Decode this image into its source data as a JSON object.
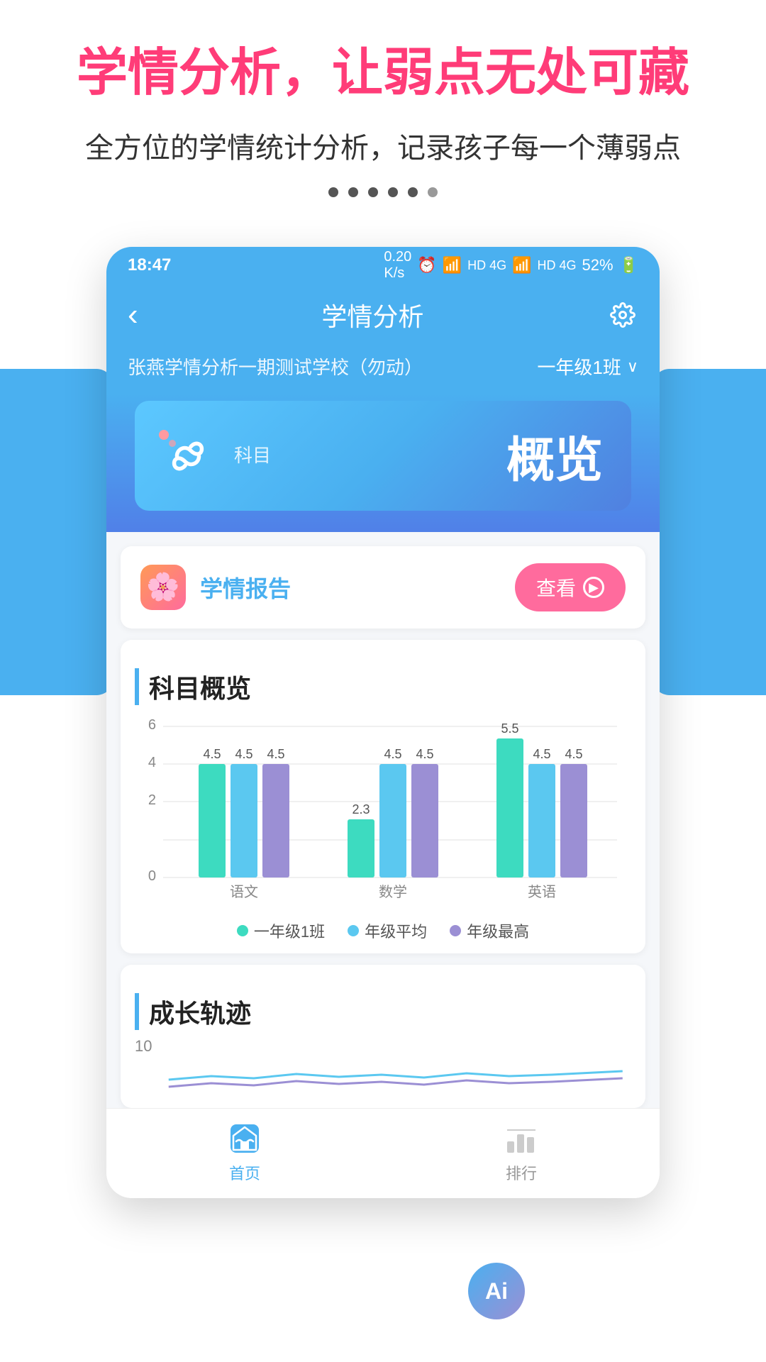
{
  "promo": {
    "title": "学情分析，让弱点无处可藏",
    "subtitle": "全方位的学情统计分析，记录孩子每一个薄弱点"
  },
  "statusBar": {
    "time": "18:47",
    "battery": "52%",
    "networkInfo": "0.20 K/s HD 4G HD 4G"
  },
  "header": {
    "title": "学情分析",
    "backLabel": "‹",
    "gearLabel": "⚙"
  },
  "schoolBar": {
    "schoolName": "张燕学情分析一期测试学校（勿动）",
    "className": "一年级1班"
  },
  "subjectCard": {
    "smallLabel": "科目",
    "largeLabel": "概览"
  },
  "reportCard": {
    "title": "学情报告",
    "viewButton": "查看",
    "icon": "🌸"
  },
  "subjectChart": {
    "sectionTitle": "科目概览",
    "yMax": 6,
    "yLabels": [
      "6",
      "4",
      "2",
      "0"
    ],
    "subjects": [
      {
        "name": "语文",
        "bars": [
          {
            "label": "一年级1班",
            "value": 4.5,
            "color": "#3ddbc0"
          },
          {
            "label": "年级平均",
            "value": 4.5,
            "color": "#5bc8f0"
          },
          {
            "label": "年级最高",
            "value": 4.5,
            "color": "#9b8fd4"
          }
        ]
      },
      {
        "name": "数学",
        "bars": [
          {
            "label": "一年级1班",
            "value": 2.3,
            "color": "#3ddbc0"
          },
          {
            "label": "年级平均",
            "value": 4.5,
            "color": "#5bc8f0"
          },
          {
            "label": "年级最高",
            "value": 4.5,
            "color": "#9b8fd4"
          }
        ]
      },
      {
        "name": "英语",
        "bars": [
          {
            "label": "一年级1班",
            "value": 5.5,
            "color": "#3ddbc0"
          },
          {
            "label": "年级平均",
            "value": 4.5,
            "color": "#5bc8f0"
          },
          {
            "label": "年级最高",
            "value": 4.5,
            "color": "#9b8fd4"
          }
        ]
      }
    ],
    "legend": [
      {
        "label": "一年级1班",
        "color": "#3ddbc0"
      },
      {
        "label": "年级平均",
        "color": "#5bc8f0"
      },
      {
        "label": "年级最高",
        "color": "#9b8fd4"
      }
    ]
  },
  "growthSection": {
    "sectionTitle": "成长轨迹",
    "yMax": 10
  },
  "bottomNav": {
    "items": [
      {
        "label": "首页",
        "active": true,
        "iconName": "home-icon"
      },
      {
        "label": "排行",
        "active": false,
        "iconName": "rank-icon"
      }
    ]
  },
  "aiLabel": "Ai"
}
